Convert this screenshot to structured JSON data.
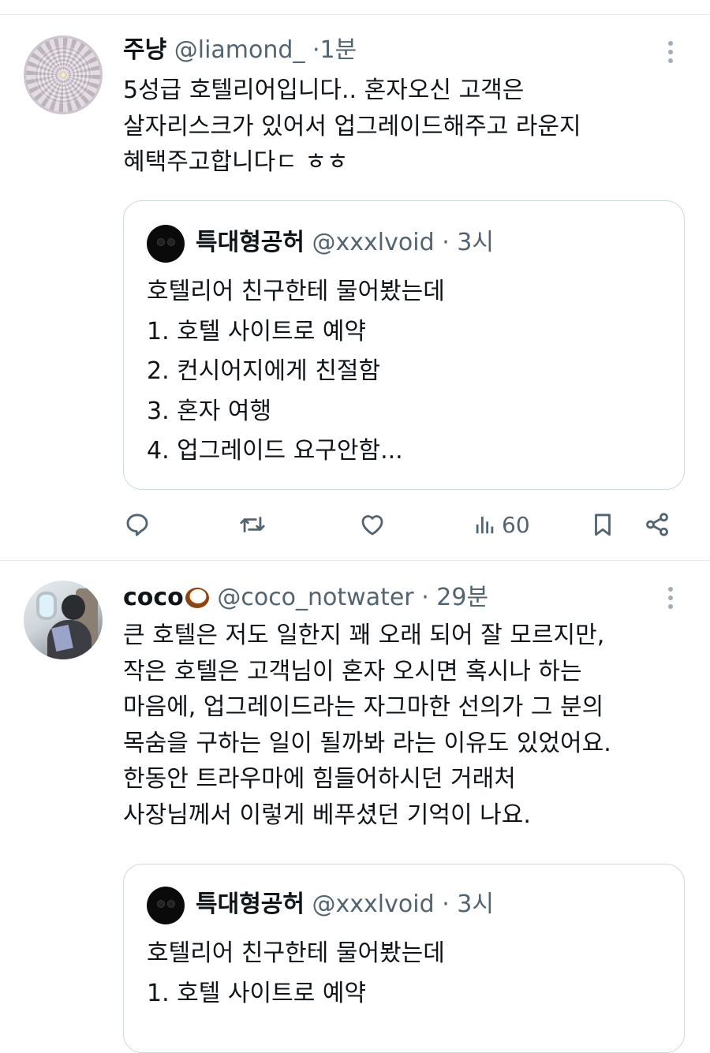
{
  "tweets": [
    {
      "name": "주냥",
      "handle": "@liamond_",
      "separator": "·",
      "time": "1분",
      "text": "5성급 호텔리어입니다.. 혼자오신 고객은\n살자리스크가 있어서 업그레이드해주고 라운지\n혜택주고합니다ㄷ ㅎㅎ",
      "quote": {
        "name": "특대형공허",
        "handle": "@xxxlvoid",
        "separator": "·",
        "time": "3시",
        "text": "호텔리어 친구한테 물어봤는데\n1. 호텔 사이트로 예약\n2. 컨시어지에게 친절함\n3. 혼자 여행\n4. 업그레이드 요구안함..."
      },
      "actions": {
        "views": "60",
        "icons": [
          "reply-icon",
          "retweet-icon",
          "like-icon",
          "views-icon",
          "bookmark-icon",
          "share-icon"
        ]
      }
    },
    {
      "name": "coco",
      "name_emoji": "coconut-icon",
      "handle": "@coco_notwater",
      "separator": "·",
      "time": "29분",
      "text": "큰 호텔은 저도 일한지 꽤 오래 되어 잘 모르지만,\n작은 호텔은 고객님이 혼자 오시면 혹시나 하는\n마음에, 업그레이드라는 자그마한 선의가 그 분의\n목숨을 구하는 일이 될까봐 라는 이유도 있었어요.\n한동안 트라우마에 힘들어하시던 거래처\n사장님께서 이렇게 베푸셨던 기억이 나요.",
      "quote": {
        "name": "특대형공허",
        "handle": "@xxxlvoid",
        "separator": "·",
        "time": "3시",
        "text": "호텔리어 친구한테 물어봤는데\n1. 호텔 사이트로 예약"
      }
    }
  ],
  "colors": {
    "text": "#0f1419",
    "secondary": "#536471",
    "border": "#cfd9de",
    "divider": "#e6e8ea"
  }
}
